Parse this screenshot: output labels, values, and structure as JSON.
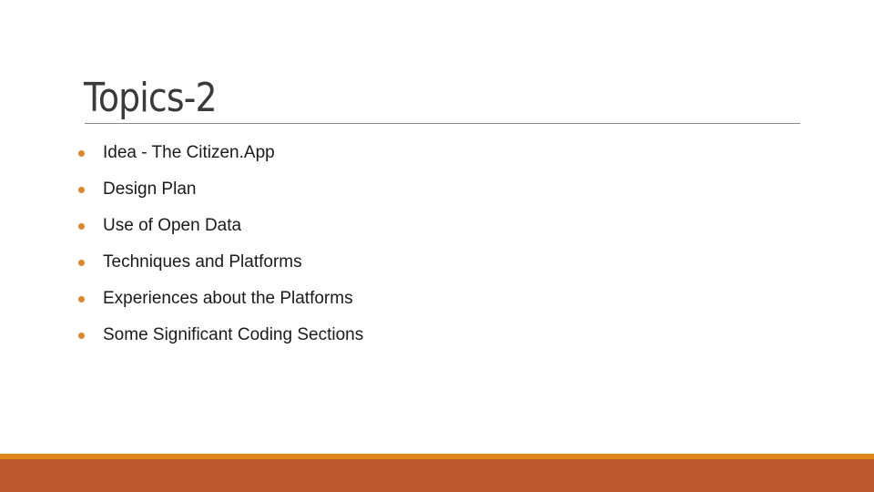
{
  "slide": {
    "title": "Topics-2",
    "bullets": [
      "Idea - The Citizen.App",
      "Design Plan",
      "Use of Open Data",
      "Techniques and Platforms",
      "Experiences about the Platforms",
      "Some Significant Coding Sections"
    ]
  },
  "colors": {
    "bullet": "#e0862a",
    "accent_stripe": "#e0861a",
    "footer_band": "#bd592c",
    "title_rule": "#8a8a8a"
  }
}
